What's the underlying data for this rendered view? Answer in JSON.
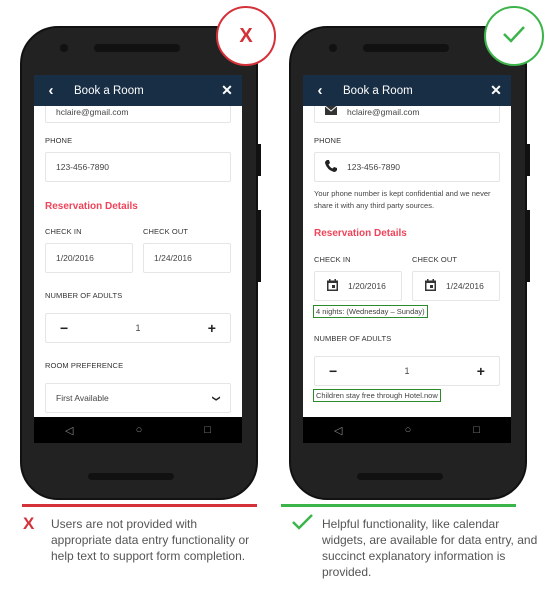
{
  "bad_example": {
    "badge_label": "X",
    "badge_color": "#d43139",
    "app_title": "Book a Room",
    "email_value": "hclaire@gmail.com",
    "phone_label": "PHONE",
    "phone_value": "123-456-7890",
    "section_title": "Reservation Details",
    "check_in_label": "CHECK IN",
    "check_in_value": "1/20/2016",
    "check_out_label": "CHECK OUT",
    "check_out_value": "1/24/2016",
    "adults_label": "NUMBER OF ADULTS",
    "adults_value": "1",
    "room_pref_label": "ROOM PREFERENCE",
    "room_pref_value": "First Available",
    "caption_mark": "X",
    "caption": "Users are not provided with appropriate data entry functionality or help text to support form completion."
  },
  "good_example": {
    "badge_color": "#3bb54a",
    "app_title": "Book a Room",
    "email_value": "hclaire@gmail.com",
    "phone_label": "PHONE",
    "phone_value": "123-456-7890",
    "phone_help": "Your phone number is kept confidential and we never share it with any third party sources.",
    "section_title": "Reservation Details",
    "check_in_label": "CHECK IN",
    "check_in_value": "1/20/2016",
    "check_out_label": "CHECK OUT",
    "check_out_value": "1/24/2016",
    "nights_hint": "4 nights: (Wednesday – Sunday)",
    "adults_label": "NUMBER OF ADULTS",
    "adults_value": "1",
    "children_hint": "Children stay free through Hotel.now",
    "caption": "Helpful functionality, like calendar widgets, are available for data entry, and succinct explanatory information is provided."
  },
  "icons": {
    "back": "‹",
    "close": "✕",
    "minus": "−",
    "plus": "+",
    "dropdown": "❯",
    "nav_back": "◁",
    "nav_home": "○",
    "nav_recent": "□"
  },
  "colors": {
    "appbar": "#172e45",
    "accent_red": "#f0435a",
    "hint_border": "#2b8a2b"
  }
}
